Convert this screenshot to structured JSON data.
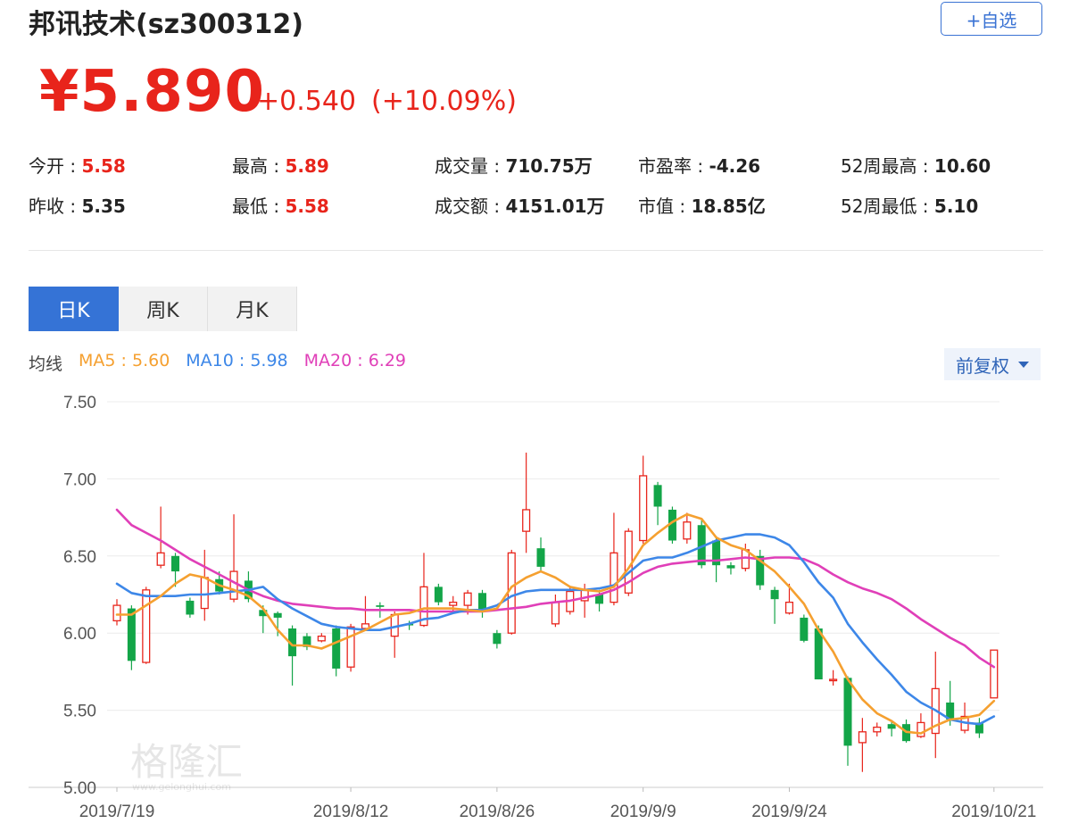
{
  "header": {
    "title": "邦讯技术(sz300312)",
    "watch_label": "+自选",
    "price": "¥5.890",
    "change": "+0.540",
    "change_pct": "(+10.09%)"
  },
  "stats": [
    {
      "label": "今开 : ",
      "value": "5.58",
      "red": true
    },
    {
      "label": "最高 : ",
      "value": "5.89",
      "red": true
    },
    {
      "label": "成交量 : ",
      "value": "710.75万",
      "red": false
    },
    {
      "label": "市盈率 : ",
      "value": "-4.26",
      "red": false
    },
    {
      "label": "52周最高 : ",
      "value": "10.60",
      "red": false
    },
    {
      "label": "昨收 : ",
      "value": "5.35",
      "red": false
    },
    {
      "label": "最低 : ",
      "value": "5.58",
      "red": true
    },
    {
      "label": "成交额 : ",
      "value": "4151.01万",
      "red": false
    },
    {
      "label": "市值 : ",
      "value": "18.85亿",
      "red": false
    },
    {
      "label": "52周最低 : ",
      "value": "5.10",
      "red": false
    }
  ],
  "tabs": [
    {
      "label": "日K",
      "active": true
    },
    {
      "label": "周K",
      "active": false
    },
    {
      "label": "月K",
      "active": false
    }
  ],
  "ma_legend": {
    "title": "均线",
    "ma5": "MA5 : 5.60",
    "ma10": "MA10 : 5.98",
    "ma20": "MA20 : 6.29"
  },
  "adjust_label": "前复权",
  "colors": {
    "up": "#e8241b",
    "down": "#13a548",
    "ma5": "#f5a030",
    "ma10": "#3d87e8",
    "ma20": "#e03fb8",
    "accent": "#3573d6"
  },
  "watermark": {
    "text": "格隆汇",
    "url": "www.gelonghui.com"
  },
  "chart_data": {
    "type": "candlestick",
    "ylim": [
      5.0,
      7.5
    ],
    "yticks": [
      "7.50",
      "7.00",
      "6.50",
      "6.00",
      "5.50",
      "5.00"
    ],
    "xticks": [
      {
        "label": "2019/7/19",
        "index": 0
      },
      {
        "label": "2019/8/12",
        "index": 16
      },
      {
        "label": "2019/8/26",
        "index": 26
      },
      {
        "label": "2019/9/9",
        "index": 36
      },
      {
        "label": "2019/9/24",
        "index": 46
      },
      {
        "label": "2019/10/21",
        "index": 60
      }
    ],
    "candles": [
      {
        "o": 6.08,
        "c": 6.18,
        "h": 6.22,
        "l": 6.05
      },
      {
        "o": 6.16,
        "c": 5.82,
        "h": 6.18,
        "l": 5.76
      },
      {
        "o": 5.81,
        "c": 6.28,
        "h": 6.3,
        "l": 5.8
      },
      {
        "o": 6.44,
        "c": 6.52,
        "h": 6.82,
        "l": 6.42
      },
      {
        "o": 6.5,
        "c": 6.4,
        "h": 6.52,
        "l": 6.3
      },
      {
        "o": 6.21,
        "c": 6.12,
        "h": 6.23,
        "l": 6.1
      },
      {
        "o": 6.16,
        "c": 6.36,
        "h": 6.54,
        "l": 6.08
      },
      {
        "o": 6.35,
        "c": 6.27,
        "h": 6.4,
        "l": 6.25
      },
      {
        "o": 6.22,
        "c": 6.4,
        "h": 6.77,
        "l": 6.2
      },
      {
        "o": 6.34,
        "c": 6.22,
        "h": 6.4,
        "l": 6.2
      },
      {
        "o": 6.15,
        "c": 6.11,
        "h": 6.18,
        "l": 6.0
      },
      {
        "o": 6.13,
        "c": 6.1,
        "h": 6.14,
        "l": 5.98
      },
      {
        "o": 6.03,
        "c": 5.85,
        "h": 6.05,
        "l": 5.66
      },
      {
        "o": 5.98,
        "c": 5.91,
        "h": 6.0,
        "l": 5.89
      },
      {
        "o": 5.95,
        "c": 5.98,
        "h": 6.0,
        "l": 5.94
      },
      {
        "o": 6.03,
        "c": 5.77,
        "h": 6.05,
        "l": 5.72
      },
      {
        "o": 5.78,
        "c": 6.04,
        "h": 6.06,
        "l": 5.75
      },
      {
        "o": 6.03,
        "c": 6.06,
        "h": 6.24,
        "l": 6.02
      },
      {
        "o": 6.18,
        "c": 6.17,
        "h": 6.2,
        "l": 6.1
      },
      {
        "o": 5.98,
        "c": 6.12,
        "h": 6.14,
        "l": 5.84
      },
      {
        "o": 6.06,
        "c": 6.05,
        "h": 6.08,
        "l": 6.02
      },
      {
        "o": 6.05,
        "c": 6.3,
        "h": 6.52,
        "l": 6.04
      },
      {
        "o": 6.3,
        "c": 6.2,
        "h": 6.32,
        "l": 6.18
      },
      {
        "o": 6.18,
        "c": 6.2,
        "h": 6.24,
        "l": 6.14
      },
      {
        "o": 6.18,
        "c": 6.26,
        "h": 6.28,
        "l": 6.12
      },
      {
        "o": 6.26,
        "c": 6.14,
        "h": 6.28,
        "l": 6.1
      },
      {
        "o": 6.0,
        "c": 5.93,
        "h": 6.02,
        "l": 5.9
      },
      {
        "o": 6.0,
        "c": 6.52,
        "h": 6.54,
        "l": 5.99
      },
      {
        "o": 6.66,
        "c": 6.8,
        "h": 7.17,
        "l": 6.52
      },
      {
        "o": 6.55,
        "c": 6.43,
        "h": 6.62,
        "l": 6.4
      },
      {
        "o": 6.06,
        "c": 6.2,
        "h": 6.25,
        "l": 6.04
      },
      {
        "o": 6.14,
        "c": 6.27,
        "h": 6.3,
        "l": 6.12
      },
      {
        "o": 6.21,
        "c": 6.28,
        "h": 6.32,
        "l": 6.1
      },
      {
        "o": 6.25,
        "c": 6.19,
        "h": 6.28,
        "l": 6.14
      },
      {
        "o": 6.2,
        "c": 6.52,
        "h": 6.78,
        "l": 6.18
      },
      {
        "o": 6.26,
        "c": 6.66,
        "h": 6.68,
        "l": 6.24
      },
      {
        "o": 6.6,
        "c": 7.02,
        "h": 7.15,
        "l": 6.58
      },
      {
        "o": 6.96,
        "c": 6.82,
        "h": 6.98,
        "l": 6.7
      },
      {
        "o": 6.8,
        "c": 6.6,
        "h": 6.82,
        "l": 6.58
      },
      {
        "o": 6.61,
        "c": 6.72,
        "h": 6.78,
        "l": 6.58
      },
      {
        "o": 6.7,
        "c": 6.44,
        "h": 6.74,
        "l": 6.42
      },
      {
        "o": 6.6,
        "c": 6.44,
        "h": 6.62,
        "l": 6.33
      },
      {
        "o": 6.44,
        "c": 6.42,
        "h": 6.46,
        "l": 6.38
      },
      {
        "o": 6.42,
        "c": 6.54,
        "h": 6.58,
        "l": 6.4
      },
      {
        "o": 6.5,
        "c": 6.31,
        "h": 6.54,
        "l": 6.28
      },
      {
        "o": 6.28,
        "c": 6.22,
        "h": 6.3,
        "l": 6.06
      },
      {
        "o": 6.13,
        "c": 6.2,
        "h": 6.32,
        "l": 6.12
      },
      {
        "o": 6.1,
        "c": 5.95,
        "h": 6.12,
        "l": 5.94
      },
      {
        "o": 6.03,
        "c": 5.7,
        "h": 6.05,
        "l": 5.7
      },
      {
        "o": 5.7,
        "c": 5.7,
        "h": 5.76,
        "l": 5.66
      },
      {
        "o": 5.71,
        "c": 5.27,
        "h": 5.72,
        "l": 5.14
      },
      {
        "o": 5.29,
        "c": 5.36,
        "h": 5.45,
        "l": 5.1
      },
      {
        "o": 5.36,
        "c": 5.39,
        "h": 5.42,
        "l": 5.33
      },
      {
        "o": 5.41,
        "c": 5.38,
        "h": 5.43,
        "l": 5.33
      },
      {
        "o": 5.41,
        "c": 5.3,
        "h": 5.44,
        "l": 5.29
      },
      {
        "o": 5.33,
        "c": 5.42,
        "h": 5.48,
        "l": 5.32
      },
      {
        "o": 5.35,
        "c": 5.64,
        "h": 5.88,
        "l": 5.19
      },
      {
        "o": 5.55,
        "c": 5.44,
        "h": 5.69,
        "l": 5.4
      },
      {
        "o": 5.37,
        "c": 5.46,
        "h": 5.55,
        "l": 5.35
      },
      {
        "o": 5.42,
        "c": 5.35,
        "h": 5.45,
        "l": 5.32
      },
      {
        "o": 5.58,
        "c": 5.89,
        "h": 5.89,
        "l": 5.58
      }
    ],
    "ma5": [
      6.12,
      6.12,
      6.18,
      6.24,
      6.32,
      6.38,
      6.36,
      6.31,
      6.28,
      6.24,
      6.16,
      6.02,
      5.92,
      5.92,
      5.9,
      5.94,
      5.98,
      6.02,
      6.07,
      6.12,
      6.13,
      6.16,
      6.16,
      6.16,
      6.15,
      6.14,
      6.16,
      6.3,
      6.36,
      6.4,
      6.36,
      6.3,
      6.28,
      6.27,
      6.3,
      6.42,
      6.57,
      6.65,
      6.72,
      6.77,
      6.74,
      6.62,
      6.57,
      6.54,
      6.47,
      6.4,
      6.3,
      6.19,
      6.02,
      5.88,
      5.7,
      5.57,
      5.48,
      5.43,
      5.36,
      5.35,
      5.4,
      5.44,
      5.45,
      5.47,
      5.56
    ],
    "ma10": [
      6.32,
      6.26,
      6.24,
      6.24,
      6.24,
      6.25,
      6.25,
      6.26,
      6.27,
      6.28,
      6.3,
      6.22,
      6.16,
      6.11,
      6.06,
      6.04,
      6.03,
      6.02,
      6.02,
      6.04,
      6.06,
      6.09,
      6.1,
      6.13,
      6.15,
      6.15,
      6.18,
      6.24,
      6.27,
      6.28,
      6.28,
      6.28,
      6.28,
      6.29,
      6.31,
      6.39,
      6.47,
      6.49,
      6.49,
      6.52,
      6.56,
      6.6,
      6.62,
      6.64,
      6.64,
      6.62,
      6.57,
      6.46,
      6.33,
      6.23,
      6.06,
      5.94,
      5.83,
      5.73,
      5.62,
      5.55,
      5.5,
      5.44,
      5.42,
      5.41,
      5.46
    ],
    "ma20": [
      6.8,
      6.7,
      6.65,
      6.6,
      6.54,
      6.48,
      6.43,
      6.38,
      6.33,
      6.28,
      6.24,
      6.21,
      6.19,
      6.18,
      6.17,
      6.16,
      6.16,
      6.15,
      6.15,
      6.15,
      6.15,
      6.14,
      6.14,
      6.14,
      6.14,
      6.14,
      6.15,
      6.16,
      6.17,
      6.19,
      6.2,
      6.21,
      6.23,
      6.25,
      6.28,
      6.33,
      6.39,
      6.43,
      6.45,
      6.46,
      6.47,
      6.47,
      6.48,
      6.49,
      6.48,
      6.49,
      6.49,
      6.48,
      6.44,
      6.38,
      6.33,
      6.29,
      6.26,
      6.22,
      6.16,
      6.09,
      6.03,
      5.97,
      5.92,
      5.84,
      5.78
    ]
  }
}
